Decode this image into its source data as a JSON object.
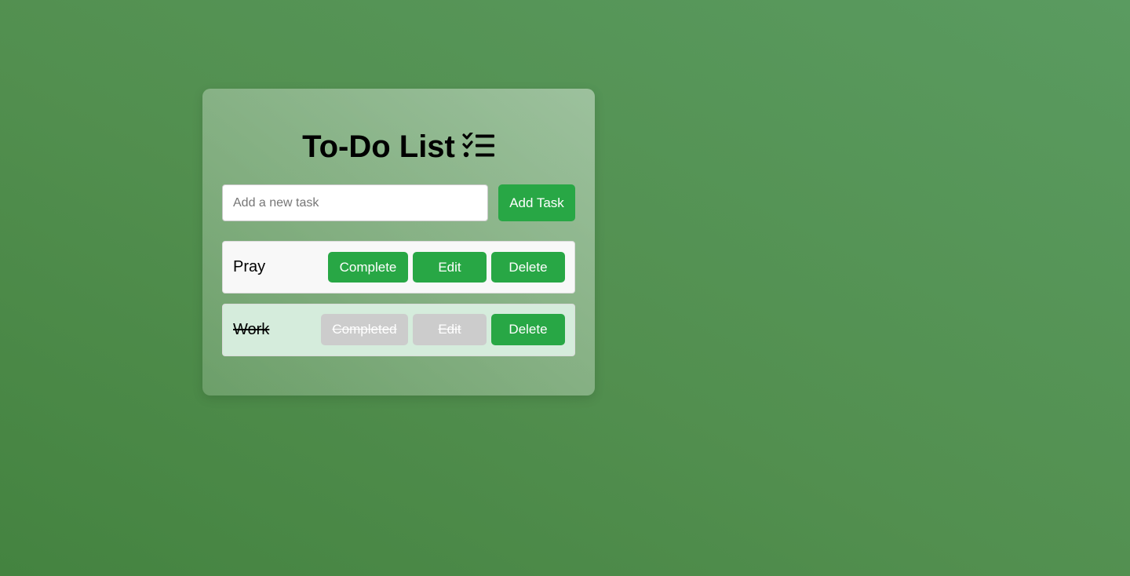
{
  "app": {
    "title": "To-Do List",
    "title_icon": "checklist-icon"
  },
  "new_task": {
    "placeholder": "Add a new task",
    "value": "",
    "add_label": "Add Task"
  },
  "tasks": [
    {
      "label": "Pray",
      "completed": false,
      "complete_label": "Complete",
      "edit_label": "Edit",
      "delete_label": "Delete"
    },
    {
      "label": "Work",
      "completed": true,
      "complete_label": "Completed",
      "edit_label": "Edit",
      "delete_label": "Delete"
    }
  ],
  "colors": {
    "accent": "#28a745",
    "disabled": "#cccccc",
    "completed_row": "#d5ecdc",
    "pending_row": "#f8f8f8"
  }
}
